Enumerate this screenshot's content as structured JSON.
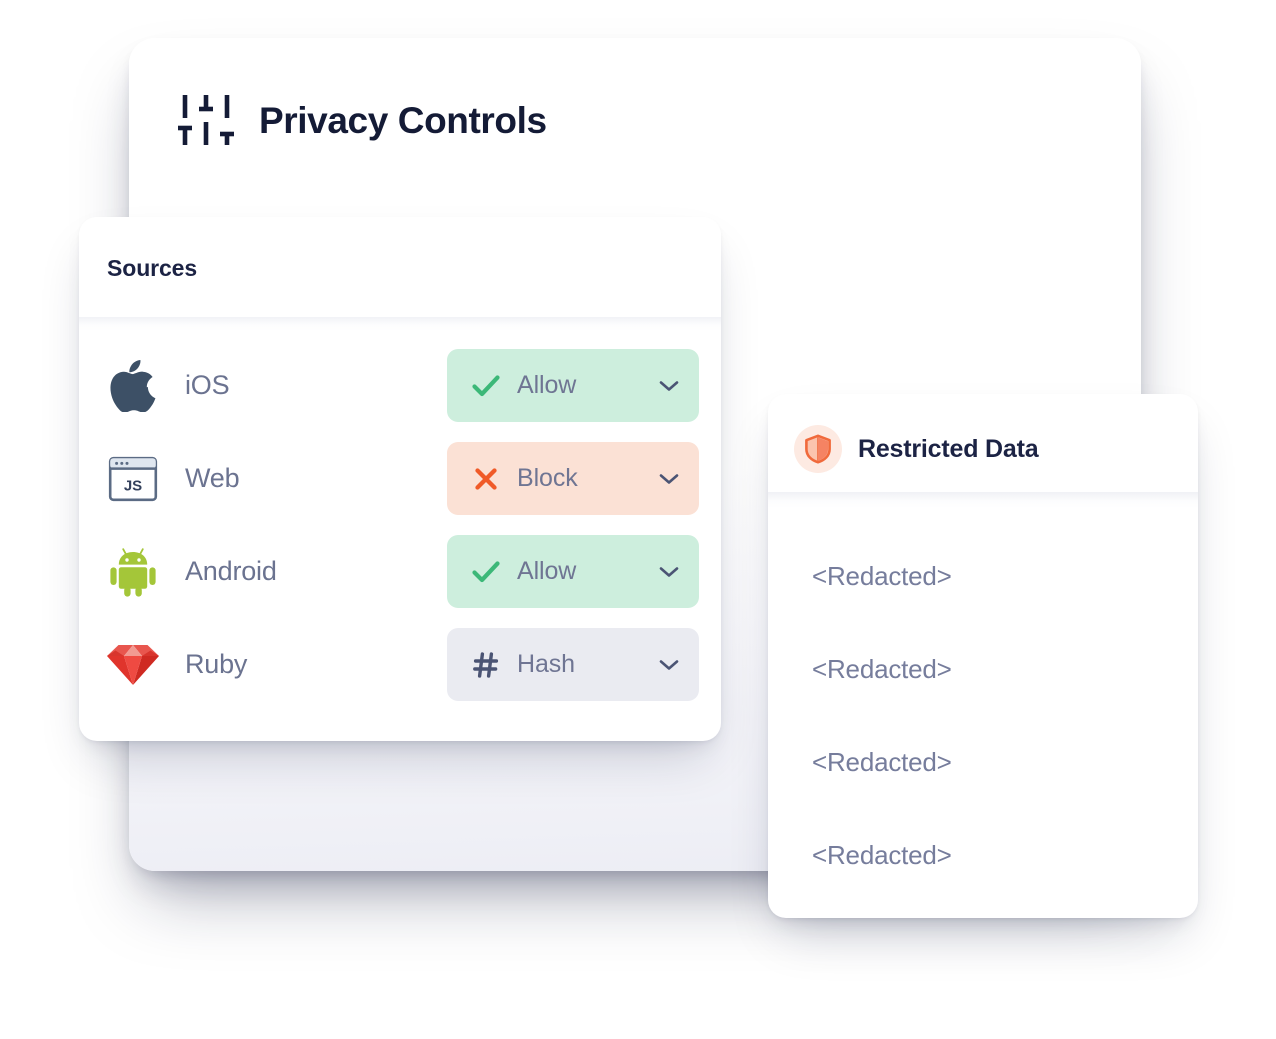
{
  "base_card": {
    "title": "Privacy Controls",
    "icon": "sliders-icon"
  },
  "sources_card": {
    "header_label": "Sources",
    "rows": [
      {
        "icon": "apple-icon",
        "platform": "iOS",
        "action_label": "Allow",
        "action_glyph": "check-icon",
        "action_style": "allow",
        "chevron": "chevron-down-icon"
      },
      {
        "icon": "browser-js-icon",
        "platform": "Web",
        "action_label": "Block",
        "action_glyph": "cross-icon",
        "action_style": "block",
        "chevron": "chevron-down-icon"
      },
      {
        "icon": "android-icon",
        "platform": "Android",
        "action_label": "Allow",
        "action_glyph": "check-icon",
        "action_style": "allow",
        "chevron": "chevron-down-icon"
      },
      {
        "icon": "ruby-gem-icon",
        "platform": "Ruby",
        "action_label": "Hash",
        "action_glyph": "hash-icon",
        "action_style": "hash",
        "chevron": "chevron-down-icon"
      }
    ]
  },
  "restricted_card": {
    "title": "Restricted Data",
    "icon": "shield-icon",
    "rows": [
      {
        "text": "<Redacted>"
      },
      {
        "text": "<Redacted>"
      },
      {
        "text": "<Redacted>"
      },
      {
        "text": "<Redacted>"
      }
    ]
  },
  "colors": {
    "title_navy": "#141b36",
    "label_slate": "#6b7390",
    "allow_bg": "#cdeedd",
    "allow_glyph": "#3cb878",
    "block_bg": "#fbe1d5",
    "block_glyph": "#f05a28",
    "hash_bg": "#eaebf1",
    "hash_glyph": "#4b5474",
    "shield_orange": "#f06a3c",
    "shield_badge_bg": "#fdeae2",
    "android_green": "#a4c639",
    "ruby_red": "#e02f28",
    "apple_slate": "#3d5066"
  }
}
